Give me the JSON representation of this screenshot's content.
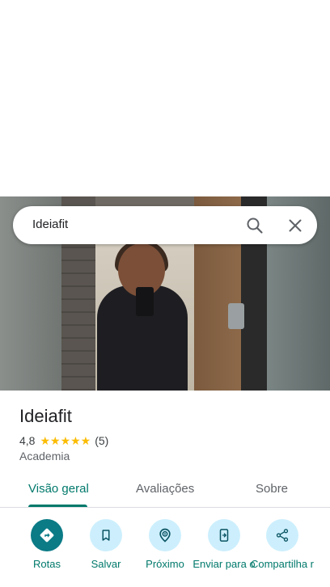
{
  "search": {
    "query": "Ideiafit"
  },
  "place": {
    "name": "Ideiafit",
    "rating": "4,8",
    "stars": "★★★★★",
    "review_count": "(5)",
    "category": "Academia"
  },
  "tabs": [
    {
      "label": "Visão geral",
      "active": true
    },
    {
      "label": "Avaliações",
      "active": false
    },
    {
      "label": "Sobre",
      "active": false
    }
  ],
  "actions": [
    {
      "label": "Rotas",
      "icon": "directions-icon"
    },
    {
      "label": "Salvar",
      "icon": "bookmark-icon"
    },
    {
      "label": "Próximo",
      "icon": "nearby-icon"
    },
    {
      "label": "Enviar para o",
      "icon": "send-to-phone-icon"
    },
    {
      "label": "Compartilha r",
      "icon": "share-icon"
    }
  ],
  "colors": {
    "accent": "#00796b",
    "primary_action": "#0b7b86",
    "action_bg": "#cdeffd",
    "star": "#fbbc04"
  }
}
